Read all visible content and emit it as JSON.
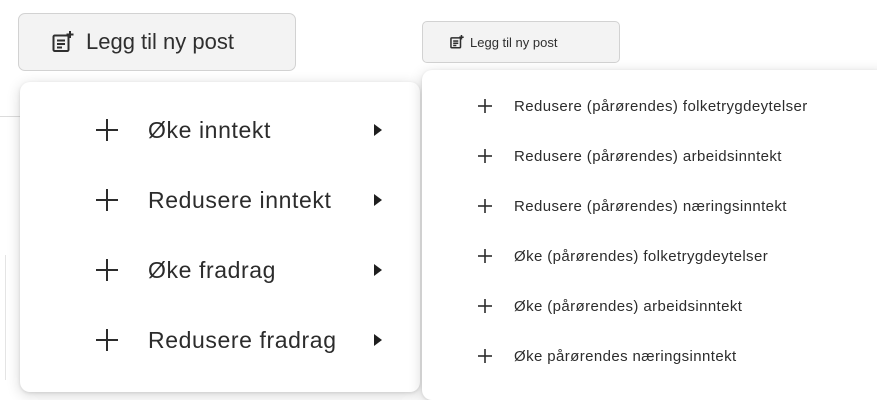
{
  "toolbar": {
    "add_post_large_label": "Legg til ny post",
    "add_post_small_label": "Legg til ny post",
    "add_icon": "note-add-icon"
  },
  "main_menu": {
    "items": [
      {
        "label": "Øke inntekt",
        "icon": "plus-icon",
        "submenu_icon": "caret-right-icon"
      },
      {
        "label": "Redusere inntekt",
        "icon": "plus-icon",
        "submenu_icon": "caret-right-icon"
      },
      {
        "label": "Øke fradrag",
        "icon": "plus-icon",
        "submenu_icon": "caret-right-icon"
      },
      {
        "label": "Redusere fradrag",
        "icon": "plus-icon",
        "submenu_icon": "caret-right-icon"
      }
    ]
  },
  "sub_menu": {
    "items": [
      {
        "label": "Redusere (pårørendes) folketrygdeytelser",
        "icon": "plus-icon"
      },
      {
        "label": "Redusere (pårørendes) arbeidsinntekt",
        "icon": "plus-icon"
      },
      {
        "label": "Redusere (pårørendes) næringsinntekt",
        "icon": "plus-icon"
      },
      {
        "label": "Øke (pårørendes) folketrygdeytelser",
        "icon": "plus-icon"
      },
      {
        "label": "Øke (pårørendes) arbeidsinntekt",
        "icon": "plus-icon"
      },
      {
        "label": "Øke pårørendes næringsinntekt",
        "icon": "plus-icon"
      }
    ]
  },
  "colors": {
    "button_bg": "#f3f3f3",
    "button_border": "#d2d2d2",
    "text": "#2c2c2c",
    "menu_bg": "#ffffff"
  }
}
